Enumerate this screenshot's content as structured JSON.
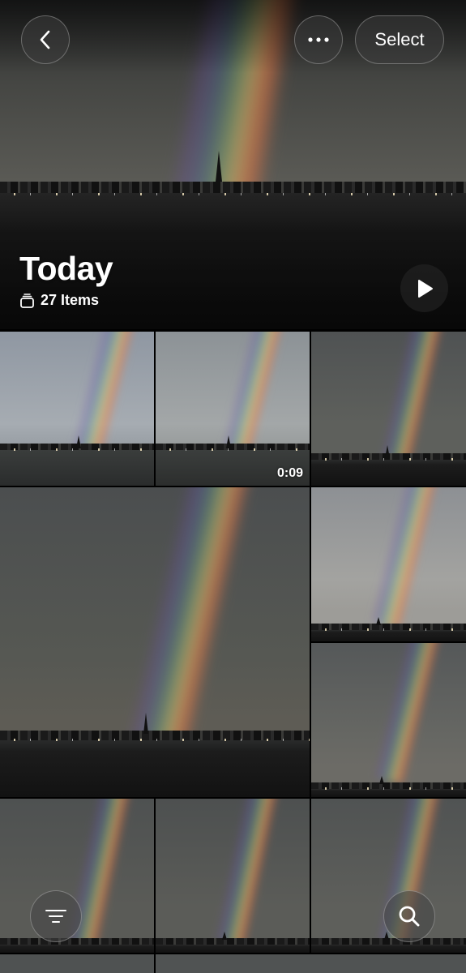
{
  "header": {
    "title": "Today",
    "item_count": "27 Items",
    "select_label": "Select"
  },
  "icons": {
    "back": "chevron-left-icon",
    "more": "ellipsis-icon",
    "stack": "stack-icon",
    "play": "play-icon",
    "filter": "filter-lines-icon",
    "search": "magnifier-icon"
  },
  "grid": {
    "tiles": [
      {
        "kind": "photo"
      },
      {
        "kind": "video",
        "duration": "0:09"
      },
      {
        "kind": "photo"
      },
      {
        "kind": "photo"
      },
      {
        "kind": "photo"
      },
      {
        "kind": "photo"
      },
      {
        "kind": "photo"
      },
      {
        "kind": "photo"
      },
      {
        "kind": "photo"
      },
      {
        "kind": "photo"
      },
      {
        "kind": "photo"
      }
    ]
  }
}
